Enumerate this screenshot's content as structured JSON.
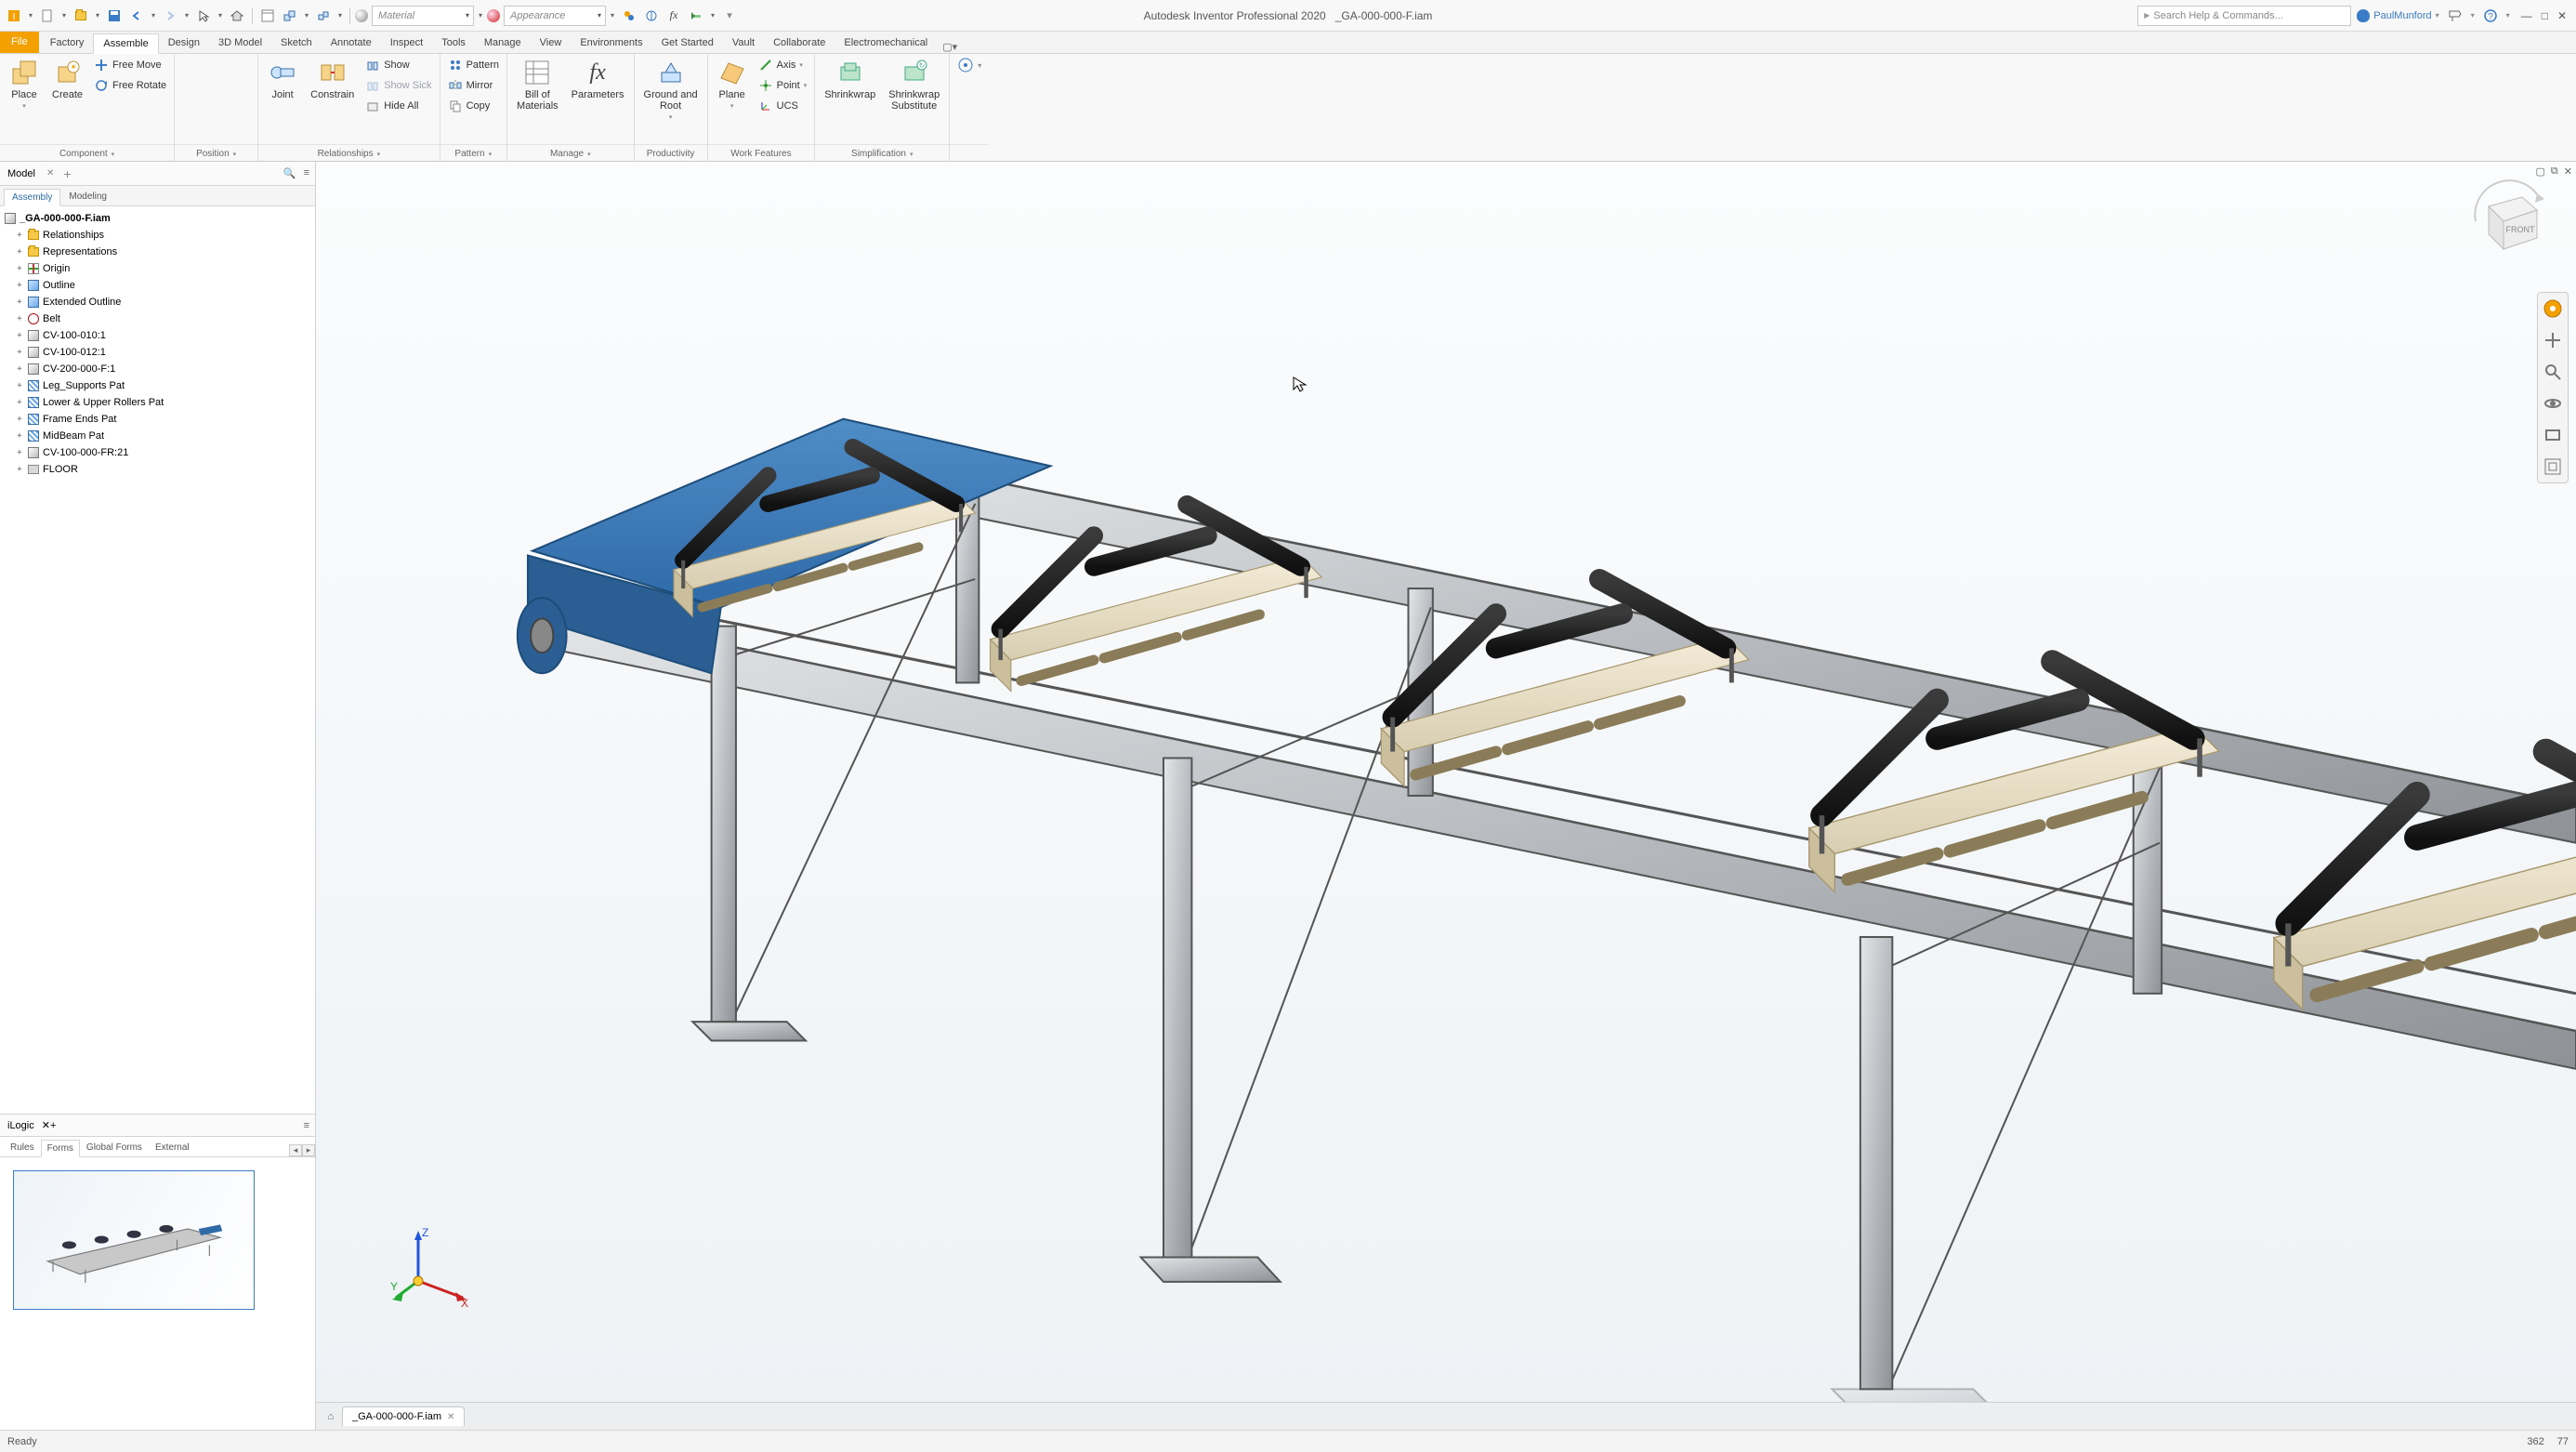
{
  "app": {
    "title": "Autodesk Inventor Professional 2020",
    "document": "_GA-000-000-F.iam",
    "search_placeholder": "Search Help & Commands...",
    "user": "PaulMunford"
  },
  "qat": {
    "material_placeholder": "Material",
    "appearance_placeholder": "Appearance"
  },
  "ribbon_tabs": {
    "file": "File",
    "items": [
      "Factory",
      "Assemble",
      "Design",
      "3D Model",
      "Sketch",
      "Annotate",
      "Inspect",
      "Tools",
      "Manage",
      "View",
      "Environments",
      "Get Started",
      "Vault",
      "Collaborate",
      "Electromechanical"
    ],
    "active": "Assemble"
  },
  "ribbon": {
    "component": {
      "place": "Place",
      "create": "Create",
      "free_move": "Free Move",
      "free_rotate": "Free Rotate",
      "title": "Component"
    },
    "position": {
      "title": "Position"
    },
    "relationships": {
      "joint": "Joint",
      "constrain": "Constrain",
      "show": "Show",
      "show_sick": "Show Sick",
      "hide_all": "Hide All",
      "title": "Relationships"
    },
    "pattern": {
      "pattern": "Pattern",
      "mirror": "Mirror",
      "copy": "Copy",
      "title": "Pattern"
    },
    "manage": {
      "bom": "Bill of\nMaterials",
      "params": "Parameters",
      "title": "Manage"
    },
    "productivity": {
      "ground": "Ground and\nRoot",
      "title": "Productivity"
    },
    "work": {
      "plane": "Plane",
      "axis": "Axis",
      "point": "Point",
      "ucs": "UCS",
      "title": "Work Features"
    },
    "simplification": {
      "shrinkwrap": "Shrinkwrap",
      "shrinkwrap_sub": "Shrinkwrap\nSubstitute",
      "title": "Simplification"
    }
  },
  "browser": {
    "tab": "Model",
    "subtabs": {
      "assembly": "Assembly",
      "modeling": "Modeling"
    },
    "root": "_GA-000-000-F.iam",
    "nodes": [
      {
        "icon": "folder",
        "label": "Relationships"
      },
      {
        "icon": "folder",
        "label": "Representations"
      },
      {
        "icon": "origin",
        "label": "Origin"
      },
      {
        "icon": "part",
        "label": "Outline"
      },
      {
        "icon": "part",
        "label": "Extended Outline"
      },
      {
        "icon": "belt",
        "label": "Belt"
      },
      {
        "icon": "asm",
        "label": "CV-100-010:1"
      },
      {
        "icon": "asm",
        "label": "CV-100-012:1"
      },
      {
        "icon": "asm",
        "label": "CV-200-000-F:1"
      },
      {
        "icon": "pat",
        "label": "Leg_Supports Pat"
      },
      {
        "icon": "pat",
        "label": "Lower & Upper Rollers Pat"
      },
      {
        "icon": "pat",
        "label": "Frame Ends Pat"
      },
      {
        "icon": "pat",
        "label": "MidBeam Pat"
      },
      {
        "icon": "asm",
        "label": "CV-100-000-FR:21"
      },
      {
        "icon": "floor",
        "label": "FLOOR"
      }
    ]
  },
  "ilogic": {
    "header": "iLogic",
    "tabs": [
      "Rules",
      "Forms",
      "Global Forms",
      "External"
    ],
    "active": "Forms"
  },
  "doc_tab": "_GA-000-000-F.iam",
  "status": {
    "left": "Ready",
    "coord1": "362",
    "coord2": "77"
  },
  "viewcube": {
    "face": "FRONT"
  },
  "triad": {
    "x": "X",
    "y": "Y",
    "z": "Z"
  }
}
